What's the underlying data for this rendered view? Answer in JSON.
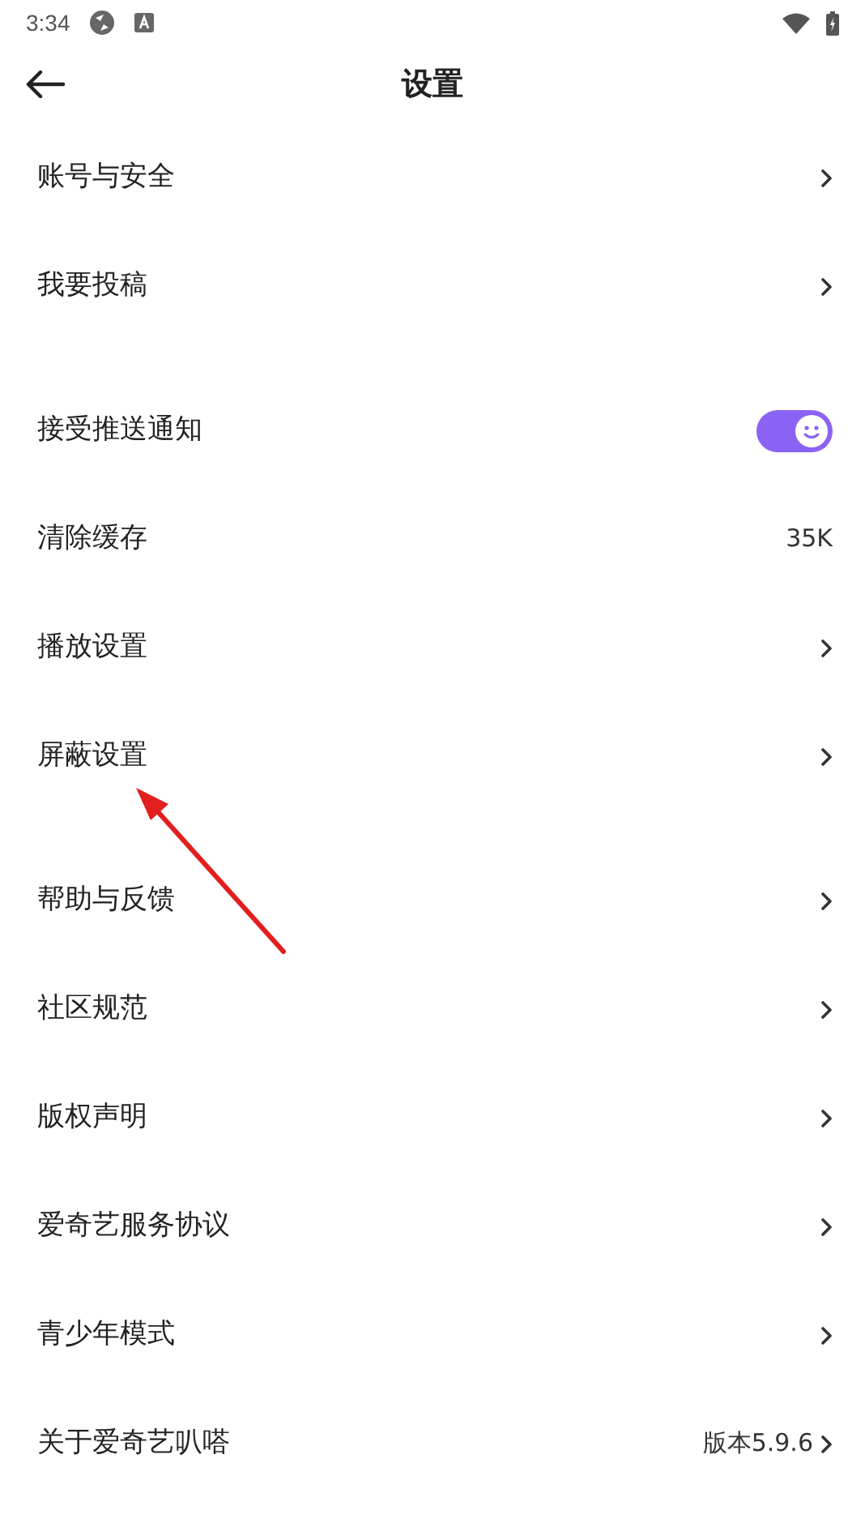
{
  "status_bar": {
    "time": "3:34"
  },
  "header": {
    "title": "设置"
  },
  "sections": [
    {
      "rows": [
        {
          "kind": "link",
          "label": "账号与安全"
        },
        {
          "kind": "link",
          "label": "我要投稿"
        }
      ]
    },
    {
      "rows": [
        {
          "kind": "toggle",
          "label": "接受推送通知",
          "on": true
        },
        {
          "kind": "value",
          "label": "清除缓存",
          "value": "35K"
        },
        {
          "kind": "link",
          "label": "播放设置"
        },
        {
          "kind": "link",
          "label": "屏蔽设置"
        }
      ]
    },
    {
      "rows": [
        {
          "kind": "link",
          "label": "帮助与反馈"
        },
        {
          "kind": "link",
          "label": "社区规范"
        },
        {
          "kind": "link",
          "label": "版权声明"
        },
        {
          "kind": "link",
          "label": "爱奇艺服务协议"
        },
        {
          "kind": "link",
          "label": "青少年模式"
        },
        {
          "kind": "value_link",
          "label": "关于爱奇艺叭嗒",
          "value": "版本5.9.6"
        }
      ]
    }
  ]
}
